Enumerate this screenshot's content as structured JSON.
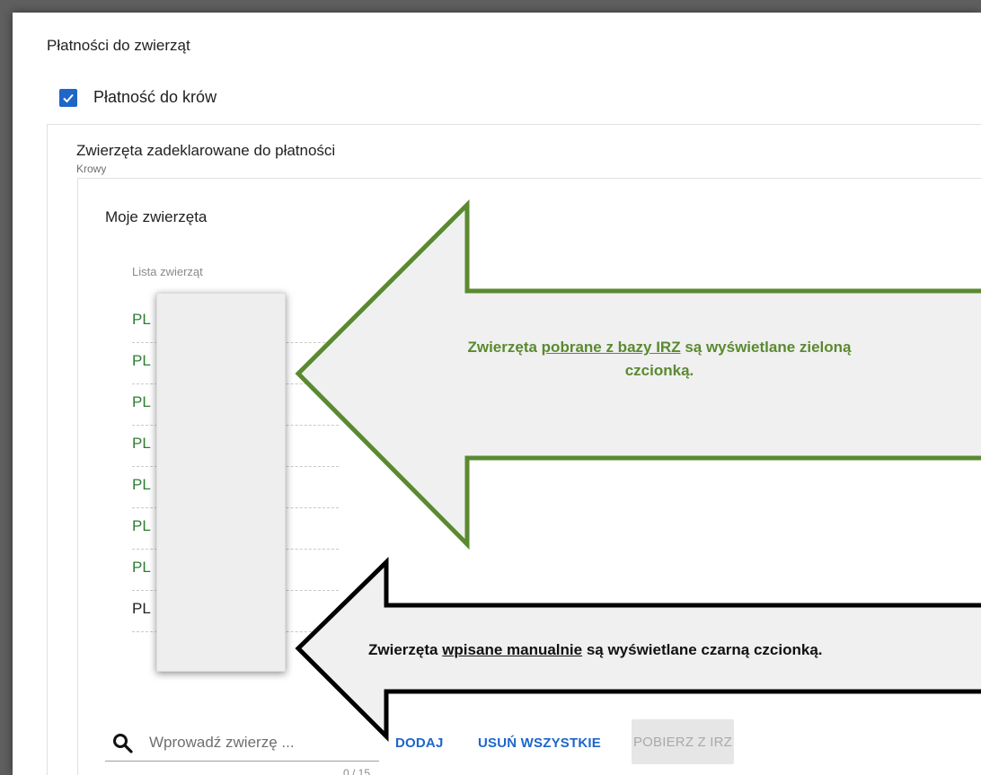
{
  "section": {
    "title": "Płatności do zwierząt"
  },
  "checkbox": {
    "label": "Płatność do krów",
    "checked": true
  },
  "group": {
    "title": "Zwierzęta zadeklarowane do płatności",
    "subtitle": "Krowy"
  },
  "animals_panel": {
    "title": "Moje zwierzęta",
    "list_label": "Lista zwierząt",
    "rows": [
      {
        "text": "PL",
        "source": "IRZ",
        "color": "#2e7d32"
      },
      {
        "text": "PL",
        "source": "IRZ",
        "color": "#2e7d32"
      },
      {
        "text": "PL",
        "source": "IRZ",
        "color": "#2e7d32"
      },
      {
        "text": "PL",
        "source": "IRZ",
        "color": "#2e7d32"
      },
      {
        "text": "PL",
        "source": "IRZ",
        "color": "#2e7d32"
      },
      {
        "text": "PL",
        "source": "IRZ",
        "color": "#2e7d32"
      },
      {
        "text": "PL",
        "source": "IRZ",
        "color": "#2e7d32"
      },
      {
        "text": "PL",
        "source": "manual",
        "color": "#212121"
      }
    ]
  },
  "search": {
    "placeholder": "Wprowadź zwierzę ...",
    "counter": "0 / 15"
  },
  "buttons": {
    "add": "DODAJ",
    "remove_all": "USUŃ WSZYSTKIE",
    "fetch_irz": "POBIERZ Z IRZ"
  },
  "callouts": {
    "green": {
      "prefix": "Zwierzęta ",
      "underlined": "pobrane z bazy IRZ",
      "suffix": " są wyświetlane zieloną czcionką.",
      "color": "#5a8a30"
    },
    "black": {
      "prefix": "Zwierzęta ",
      "underlined": "wpisane manualnie",
      "suffix": " są wyświetlane czarną czcionką.",
      "color": "#000000"
    }
  }
}
